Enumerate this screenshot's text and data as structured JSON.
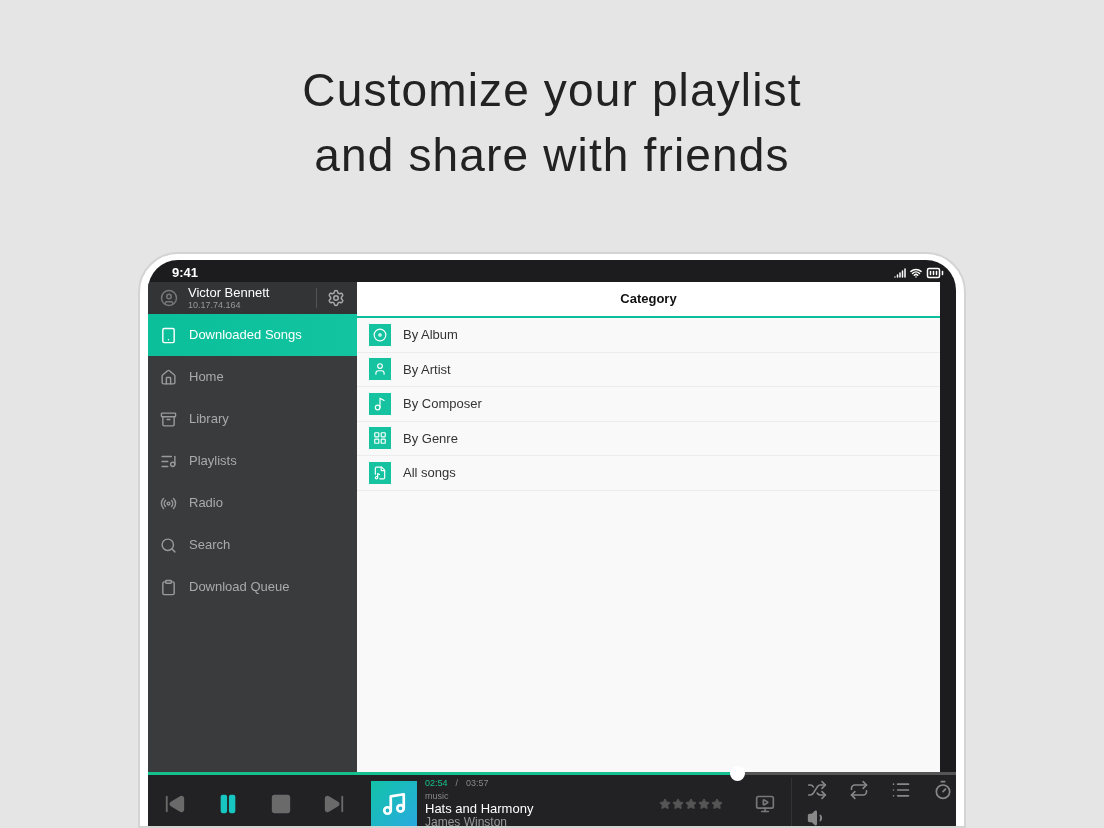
{
  "headline": [
    "Customize your playlist",
    "and share with friends"
  ],
  "status_bar": {
    "time": "9:41"
  },
  "user": {
    "name": "Victor Bennett",
    "address": "10.17.74.164"
  },
  "sidebar": {
    "items": [
      {
        "label": "Downloaded Songs",
        "selected": true
      },
      {
        "label": "Home",
        "selected": false
      },
      {
        "label": "Library",
        "selected": false
      },
      {
        "label": "Playlists",
        "selected": false
      },
      {
        "label": "Radio",
        "selected": false
      },
      {
        "label": "Search",
        "selected": false
      },
      {
        "label": "Download Queue",
        "selected": false
      }
    ]
  },
  "content": {
    "title": "Category",
    "items": [
      {
        "label": "By Album"
      },
      {
        "label": "By Artist"
      },
      {
        "label": "By Composer"
      },
      {
        "label": "By Genre"
      },
      {
        "label": "All songs"
      }
    ]
  },
  "player": {
    "level": 0.73,
    "elapsed": "02:54",
    "separator": "/",
    "duration": "03:57",
    "type": "music",
    "title": "Hats and Harmony",
    "artist": "James Winston",
    "stars": 0,
    "playing": true
  }
}
